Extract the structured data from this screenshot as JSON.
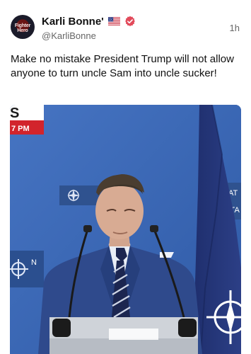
{
  "post": {
    "author_name": "Karli Bonne'",
    "handle": "@KarliBonne",
    "time": "1h",
    "text": "Make no mistake President Trump will not allow anyone to turn uncle Sam into uncle sucker!",
    "flag_icon": "us-flag-icon",
    "verified_icon": "verified-badge-icon",
    "verified_color": "#e24a5a"
  },
  "avatar": {
    "text": "Fighter Hero"
  },
  "media": {
    "banner_line1": "S",
    "banner_line2": "7 PM",
    "background_color": "#3b68b5",
    "nato_sign_right_line1": "NAT",
    "nato_sign_right_line2": "OTA",
    "nato_sign_left": "N"
  }
}
